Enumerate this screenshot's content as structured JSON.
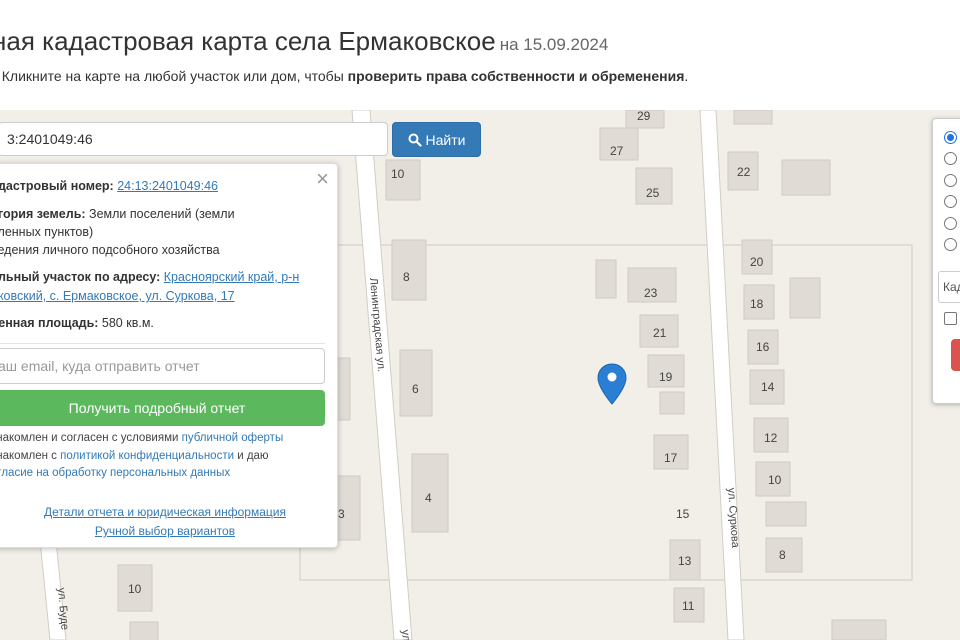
{
  "header": {
    "title": "ная кадастровая карта села Ермаковское",
    "date": "на 15.09.2024",
    "hint_prefix": ": Кликните на карте на любой участок или дом, чтобы ",
    "hint_bold": "проверить права собственности и обременения",
    "hint_suffix": "."
  },
  "search": {
    "value": "3:2401049:46",
    "button_label": "Найти"
  },
  "info_panel": {
    "cad_label": "адастровый номер:",
    "cad_value": "24:13:2401049:46",
    "category_label": "егория земель:",
    "category_value_1": "Земли поселений (земли",
    "category_value_2": "еленных пунктов)",
    "category_value_3": "ведения личного подсобного хозяйства",
    "address_label": "ельный участок по адресу:",
    "address_value_1": "Красноярский край, р-н",
    "address_value_2": "аковский, с. Ермаковское, ул. Суркова, 17",
    "area_label": "ченная площадь:",
    "area_value": "580 кв.м.",
    "email_placeholder": "аш email, куда отправить отчет",
    "get_report_label": "Получить подробный отчет",
    "agree1_prefix": "знакомлен и согласен с условиями ",
    "agree1_link": "публичной оферты",
    "agree2_prefix": "знакомлен с ",
    "agree2_link": "политикой конфиденциальности",
    "agree2_suffix": " и даю",
    "agree3_link": "огласие на обработку персональных данных",
    "details_link": "Детали отчета и юридическая информация",
    "manual_link": "Ручной выбор вариантов",
    "close_icon": "×"
  },
  "right_panel": {
    "input_value": "Кад"
  },
  "map": {
    "streets": [
      "Ленинградская ул.",
      "ул. Суркова",
      "ул. Буде",
      "ул."
    ],
    "house_numbers": [
      "29",
      "27",
      "25",
      "22",
      "10",
      "8",
      "6",
      "4",
      "3",
      "10",
      "23",
      "21",
      "19",
      "17",
      "15",
      "13",
      "11",
      "20",
      "18",
      "16",
      "14",
      "12",
      "10",
      "8"
    ]
  },
  "colors": {
    "primary": "#337ab7",
    "success": "#5cb85c",
    "danger": "#d9534f",
    "marker": "#2a7fd4"
  },
  "icons": [
    "search-icon",
    "close-icon",
    "map-marker-icon"
  ]
}
